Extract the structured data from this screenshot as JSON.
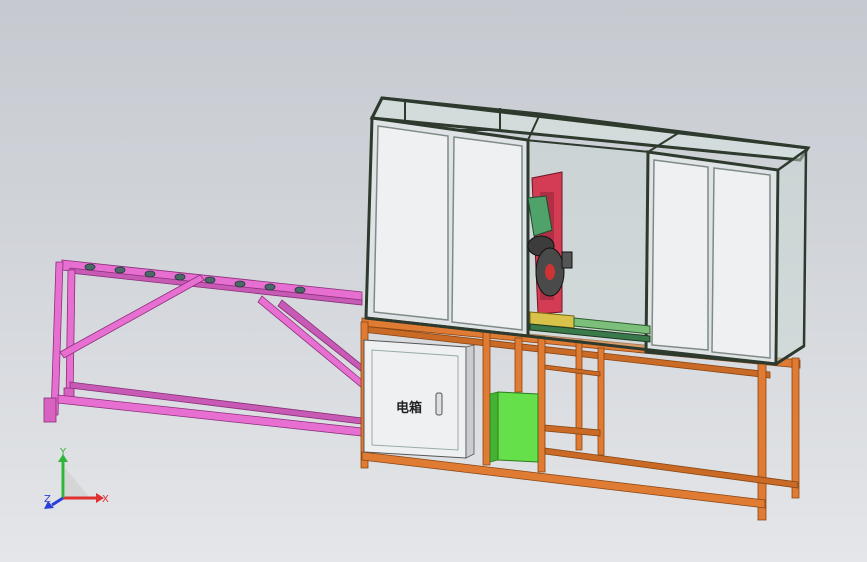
{
  "viewport": {
    "background_top": "#c6cad0",
    "background_bottom": "#e4e6e9"
  },
  "model": {
    "electrical_cabinet_label": "电箱",
    "colors": {
      "conveyor_frame": "#e86fd2",
      "machine_base": "#e07b33",
      "enclosure_frame": "#2d3a2d",
      "panel": "#eef0f2",
      "green_box": "#66e04a",
      "saw_column": "#d43c54",
      "motor": "#4fa36a"
    }
  },
  "triad": {
    "x_label": "X",
    "y_label": "Y",
    "z_label": "Z",
    "x_color": "#e03030",
    "y_color": "#2fb53a",
    "z_color": "#2b3fd8"
  }
}
